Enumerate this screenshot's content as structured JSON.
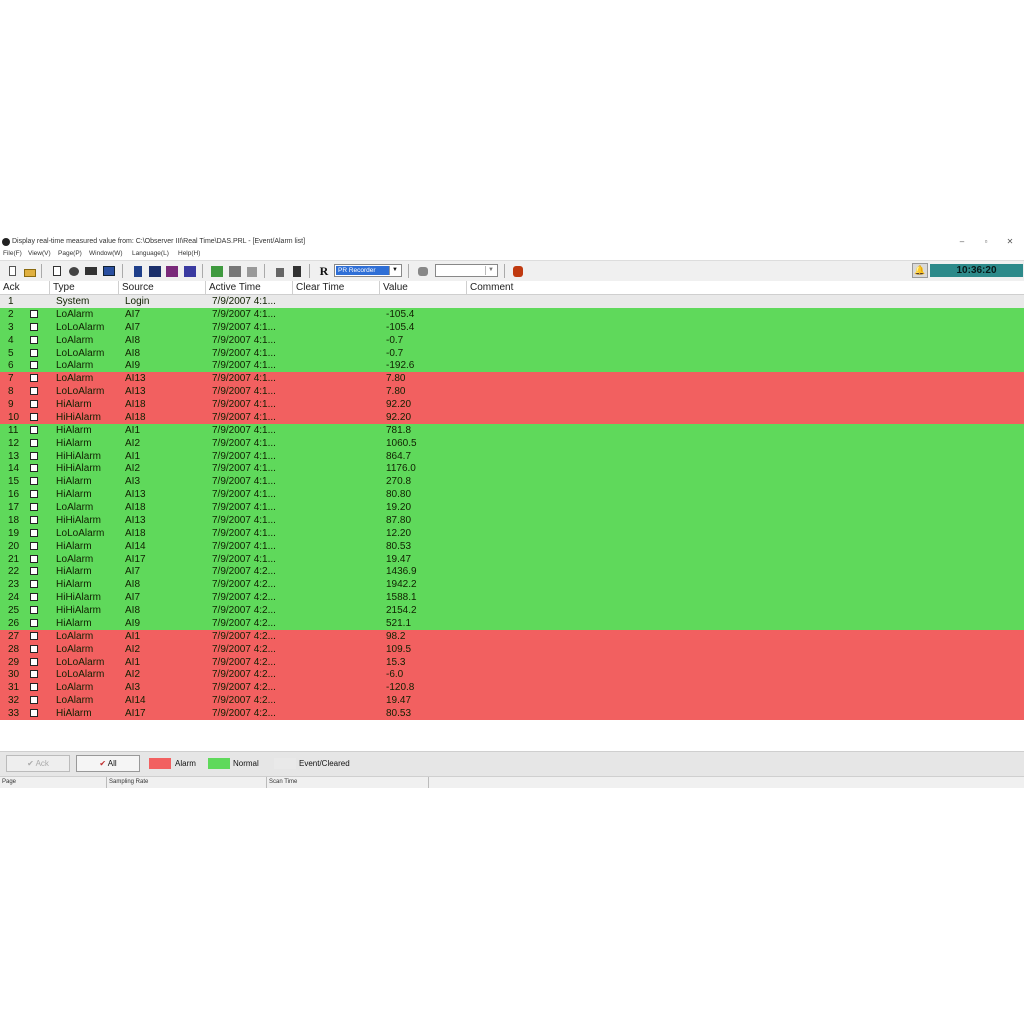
{
  "window": {
    "title": "Display real-time measured value from: C:\\Observer III\\Real Time\\DAS.PRL - [Event/Alarm list]",
    "controls": [
      "–",
      "▫",
      "✕"
    ]
  },
  "menu": [
    "File(F)",
    "View(V)",
    "Page(P)",
    "Window(W)",
    "Language(L)",
    "Help(H)"
  ],
  "toolbar": {
    "recorder_select": "PR Recorder",
    "clock": "10:36:20"
  },
  "table": {
    "headers": [
      "Ack",
      "Type",
      "Source",
      "Active Time",
      "Clear Time",
      "Value",
      "Comment"
    ],
    "rows": [
      {
        "n": "1",
        "state": "system",
        "type": "System",
        "source": "Login",
        "active": "7/9/2007 4:1...",
        "value": ""
      },
      {
        "n": "2",
        "state": "normal",
        "type": "LoAlarm",
        "source": "AI7",
        "active": "7/9/2007 4:1...",
        "value": "-105.4"
      },
      {
        "n": "3",
        "state": "normal",
        "type": "LoLoAlarm",
        "source": "AI7",
        "active": "7/9/2007 4:1...",
        "value": "-105.4"
      },
      {
        "n": "4",
        "state": "normal",
        "type": "LoAlarm",
        "source": "AI8",
        "active": "7/9/2007 4:1...",
        "value": "-0.7"
      },
      {
        "n": "5",
        "state": "normal",
        "type": "LoLoAlarm",
        "source": "AI8",
        "active": "7/9/2007 4:1...",
        "value": "-0.7"
      },
      {
        "n": "6",
        "state": "normal",
        "type": "LoAlarm",
        "source": "AI9",
        "active": "7/9/2007 4:1...",
        "value": "-192.6"
      },
      {
        "n": "7",
        "state": "alarm",
        "type": "LoAlarm",
        "source": "AI13",
        "active": "7/9/2007 4:1...",
        "value": "7.80"
      },
      {
        "n": "8",
        "state": "alarm",
        "type": "LoLoAlarm",
        "source": "AI13",
        "active": "7/9/2007 4:1...",
        "value": "7.80"
      },
      {
        "n": "9",
        "state": "alarm",
        "type": "HiAlarm",
        "source": "AI18",
        "active": "7/9/2007 4:1...",
        "value": "92.20"
      },
      {
        "n": "10",
        "state": "alarm",
        "type": "HiHiAlarm",
        "source": "AI18",
        "active": "7/9/2007 4:1...",
        "value": "92.20"
      },
      {
        "n": "11",
        "state": "normal",
        "type": "HiAlarm",
        "source": "AI1",
        "active": "7/9/2007 4:1...",
        "value": "781.8"
      },
      {
        "n": "12",
        "state": "normal",
        "type": "HiAlarm",
        "source": "AI2",
        "active": "7/9/2007 4:1...",
        "value": "1060.5"
      },
      {
        "n": "13",
        "state": "normal",
        "type": "HiHiAlarm",
        "source": "AI1",
        "active": "7/9/2007 4:1...",
        "value": "864.7"
      },
      {
        "n": "14",
        "state": "normal",
        "type": "HiHiAlarm",
        "source": "AI2",
        "active": "7/9/2007 4:1...",
        "value": "1176.0"
      },
      {
        "n": "15",
        "state": "normal",
        "type": "HiAlarm",
        "source": "AI3",
        "active": "7/9/2007 4:1...",
        "value": "270.8"
      },
      {
        "n": "16",
        "state": "normal",
        "type": "HiAlarm",
        "source": "AI13",
        "active": "7/9/2007 4:1...",
        "value": "80.80"
      },
      {
        "n": "17",
        "state": "normal",
        "type": "LoAlarm",
        "source": "AI18",
        "active": "7/9/2007 4:1...",
        "value": "19.20"
      },
      {
        "n": "18",
        "state": "normal",
        "type": "HiHiAlarm",
        "source": "AI13",
        "active": "7/9/2007 4:1...",
        "value": "87.80"
      },
      {
        "n": "19",
        "state": "normal",
        "type": "LoLoAlarm",
        "source": "AI18",
        "active": "7/9/2007 4:1...",
        "value": "12.20"
      },
      {
        "n": "20",
        "state": "normal",
        "type": "HiAlarm",
        "source": "AI14",
        "active": "7/9/2007 4:1...",
        "value": "80.53"
      },
      {
        "n": "21",
        "state": "normal",
        "type": "LoAlarm",
        "source": "AI17",
        "active": "7/9/2007 4:1...",
        "value": "19.47"
      },
      {
        "n": "22",
        "state": "normal",
        "type": "HiAlarm",
        "source": "AI7",
        "active": "7/9/2007 4:2...",
        "value": "1436.9"
      },
      {
        "n": "23",
        "state": "normal",
        "type": "HiAlarm",
        "source": "AI8",
        "active": "7/9/2007 4:2...",
        "value": "1942.2"
      },
      {
        "n": "24",
        "state": "normal",
        "type": "HiHiAlarm",
        "source": "AI7",
        "active": "7/9/2007 4:2...",
        "value": "1588.1"
      },
      {
        "n": "25",
        "state": "normal",
        "type": "HiHiAlarm",
        "source": "AI8",
        "active": "7/9/2007 4:2...",
        "value": "2154.2"
      },
      {
        "n": "26",
        "state": "normal",
        "type": "HiAlarm",
        "source": "AI9",
        "active": "7/9/2007 4:2...",
        "value": "521.1"
      },
      {
        "n": "27",
        "state": "alarm",
        "type": "LoAlarm",
        "source": "AI1",
        "active": "7/9/2007 4:2...",
        "value": "98.2"
      },
      {
        "n": "28",
        "state": "alarm",
        "type": "LoAlarm",
        "source": "AI2",
        "active": "7/9/2007 4:2...",
        "value": "109.5"
      },
      {
        "n": "29",
        "state": "alarm",
        "type": "LoLoAlarm",
        "source": "AI1",
        "active": "7/9/2007 4:2...",
        "value": "15.3"
      },
      {
        "n": "30",
        "state": "alarm",
        "type": "LoLoAlarm",
        "source": "AI2",
        "active": "7/9/2007 4:2...",
        "value": "-6.0"
      },
      {
        "n": "31",
        "state": "alarm",
        "type": "LoAlarm",
        "source": "AI3",
        "active": "7/9/2007 4:2...",
        "value": "-120.8"
      },
      {
        "n": "32",
        "state": "alarm",
        "type": "LoAlarm",
        "source": "AI14",
        "active": "7/9/2007 4:2...",
        "value": "19.47"
      },
      {
        "n": "33",
        "state": "alarm",
        "type": "HiAlarm",
        "source": "AI17",
        "active": "7/9/2007 4:2...",
        "value": "80.53"
      }
    ]
  },
  "legend": {
    "ack_label": "Ack",
    "all_label": "All",
    "items": [
      {
        "label": "Alarm",
        "color": "#f26060"
      },
      {
        "label": "Normal",
        "color": "#5fd95b"
      },
      {
        "label": "Event/Cleared",
        "color": "#e9e9e9"
      }
    ]
  },
  "statusbar": [
    "Page",
    "Sampling Rate",
    "Scan Time"
  ],
  "colors": {
    "alarm": "#f26060",
    "normal": "#5fd95b",
    "system": "#e9e9e9",
    "clock_bg": "#2d8a8a"
  }
}
